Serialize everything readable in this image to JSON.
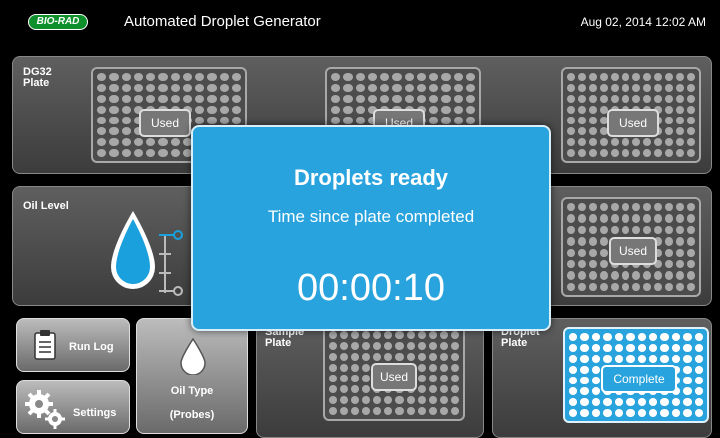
{
  "header": {
    "logo": "BIO-RAD",
    "title": "Automated Droplet Generator",
    "datetime": "Aug 02, 2014 12:02 AM"
  },
  "dg32": {
    "label": "DG32 Plate",
    "status_left": "Used",
    "status_center": "Used",
    "status_right": "Used"
  },
  "oil_level": {
    "label": "Oil Level"
  },
  "side_plate": {
    "status": "Used"
  },
  "run_log": {
    "label": "Run Log"
  },
  "settings": {
    "label": "Settings"
  },
  "oil_type": {
    "label": "Oil Type",
    "value": "(Probes)"
  },
  "sample_plate": {
    "label": "Sample Plate",
    "status": "Used"
  },
  "droplet_plate": {
    "label": "Droplet Plate",
    "status": "Complete"
  },
  "dialog": {
    "title": "Droplets ready",
    "subtitle": "Time since plate completed",
    "timer": "00:00:10"
  },
  "colors": {
    "accent": "#29a3dd",
    "logo_green": "#0d8f2c",
    "panel": "#4c4c4c"
  }
}
